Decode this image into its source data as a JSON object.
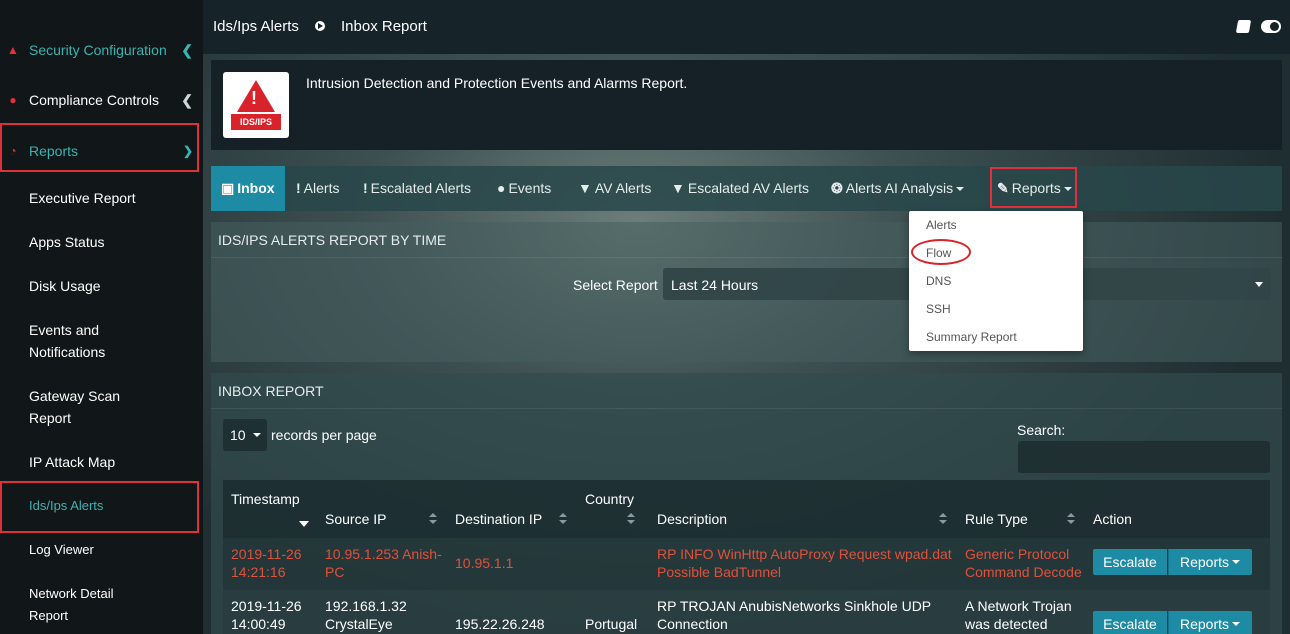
{
  "sidebar": {
    "items": [
      {
        "label": "Security Configuration",
        "icon": "shield-icon"
      },
      {
        "label": "Compliance Controls",
        "icon": "compliance-icon"
      },
      {
        "label": "Reports",
        "icon": "pie-chart-icon"
      },
      {
        "label": "Executive Report"
      },
      {
        "label": "Apps Status"
      },
      {
        "label": "Disk Usage"
      },
      {
        "label": "Events and"
      },
      {
        "label": "Notifications"
      },
      {
        "label": "Gateway Scan"
      },
      {
        "label": "Report"
      },
      {
        "label": "IP Attack Map"
      },
      {
        "label": "Ids/Ips Alerts"
      },
      {
        "label": "Log Viewer"
      },
      {
        "label": "Network Detail"
      },
      {
        "label": "Report"
      }
    ]
  },
  "breadcrumb": {
    "parent": "Ids/Ips Alerts",
    "current": "Inbox Report"
  },
  "header": {
    "logo_text": "IDS/IPS",
    "logo_symbol": "!",
    "description": "Intrusion Detection and Protection Events and Alarms Report."
  },
  "tabs": [
    {
      "label": "Inbox",
      "icon": "inbox-icon"
    },
    {
      "label": "Alerts",
      "icon": "exclamation-icon"
    },
    {
      "label": "Escalated Alerts",
      "icon": "exclamation-icon"
    },
    {
      "label": "Events",
      "icon": "info-circle-icon"
    },
    {
      "label": "AV Alerts",
      "icon": "shield-icon"
    },
    {
      "label": "Escalated AV Alerts",
      "icon": "shield-icon"
    },
    {
      "label": "Alerts AI Analysis",
      "icon": "ai-icon"
    },
    {
      "label": "Reports",
      "icon": "pencil-icon"
    }
  ],
  "reports_menu": [
    "Alerts",
    "Flow",
    "DNS",
    "SSH",
    "Summary Report"
  ],
  "report_by_time": {
    "title": "IDS/IPS ALERTS REPORT BY TIME",
    "select_label": "Select Report",
    "select_value": "Last 24 Hours"
  },
  "inbox": {
    "title": "INBOX REPORT",
    "page_length": "10",
    "page_length_label": "records per page",
    "search_label": "Search:",
    "columns": [
      "Timestamp",
      "Source IP",
      "Destination IP",
      "Country",
      "Description",
      "Rule Type",
      "Action"
    ],
    "rows": [
      {
        "timestamp": [
          "2019-11-26",
          "14:21:16"
        ],
        "source": [
          "10.95.1.253 Anish-",
          "PC"
        ],
        "destination": "10.95.1.1",
        "country": "",
        "description": [
          "RP INFO WinHttp AutoProxy Request wpad.dat",
          "Possible BadTunnel"
        ],
        "rule_type": [
          "Generic Protocol",
          "Command Decode"
        ],
        "escalate": "Escalate",
        "reports": "Reports"
      },
      {
        "timestamp": [
          "2019-11-26",
          "14:00:49"
        ],
        "source": [
          "192.168.1.32",
          "CrystalEye"
        ],
        "destination": "195.22.26.248",
        "country": "Portugal",
        "description": [
          "RP TROJAN AnubisNetworks Sinkhole UDP",
          "Connection"
        ],
        "rule_type": [
          "A Network Trojan",
          "was detected"
        ],
        "escalate": "Escalate",
        "reports": "Reports"
      }
    ]
  },
  "colors": {
    "accent": "#1e8ba4",
    "teal_text": "#3ab3b3",
    "alert_red": "#e0513a",
    "highlight_red": "#e0313a"
  }
}
